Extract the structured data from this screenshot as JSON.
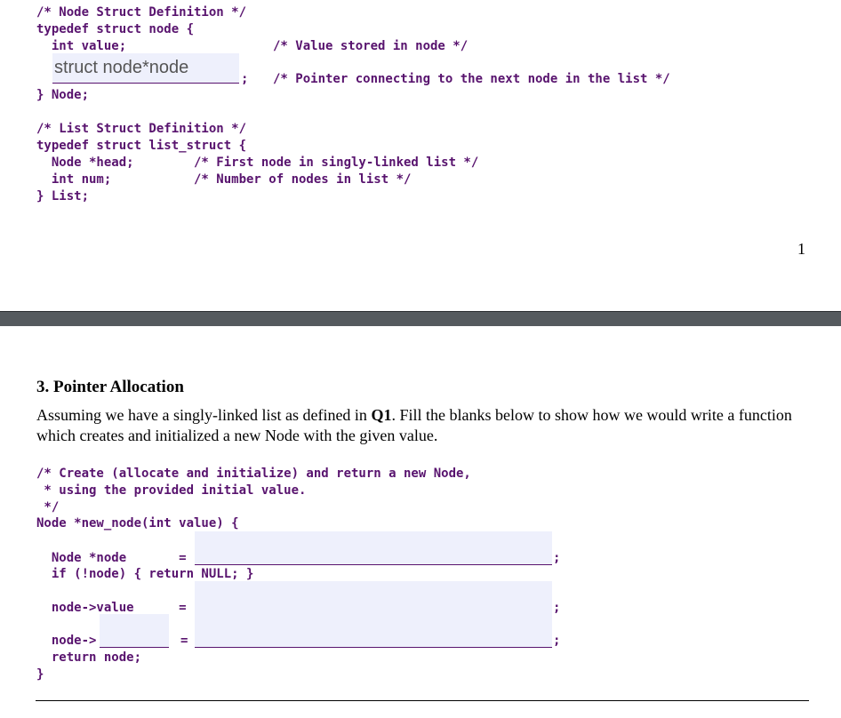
{
  "top_code": {
    "node_struct": [
      "/* Node Struct Definition */",
      "typedef struct node {",
      "  int value;",
      "} Node;"
    ],
    "value_comment": "/* Value stored in node */",
    "next_field_value": "struct node*node",
    "next_semicolon": ";",
    "next_comment": "/* Pointer connecting to the next node in the list */",
    "list_struct": [
      "/* List Struct Definition */",
      "typedef struct list_struct {",
      "  Node *head;        /* First node in singly-linked list */",
      "  int num;           /* Number of nodes in list */",
      "} List;"
    ]
  },
  "page_number": "1",
  "section": {
    "heading": "3. Pointer Allocation",
    "para_before": "Assuming we have a singly-linked list as defined in ",
    "para_bold": "Q1",
    "para_after": ". Fill the blanks below to show how we would write a function which creates and initialized a new Node with the given value."
  },
  "bottom_code": {
    "comment": [
      "/* Create (allocate and initialize) and return a new Node,",
      " * using the provided initial value.",
      " */"
    ],
    "signature": "Node *new_node(int value) {",
    "line_node": "  Node *node       =",
    "line_if": "  if (!node) { return NULL; }",
    "line_value": "  node->value      =",
    "line_field_prefix": "  node->",
    "line_field_eq": "=",
    "line_return": "  return node;",
    "close": "}",
    "semicolon": ";",
    "blank_node": "",
    "blank_value": "",
    "blank_field": "",
    "blank_field_rhs": ""
  }
}
